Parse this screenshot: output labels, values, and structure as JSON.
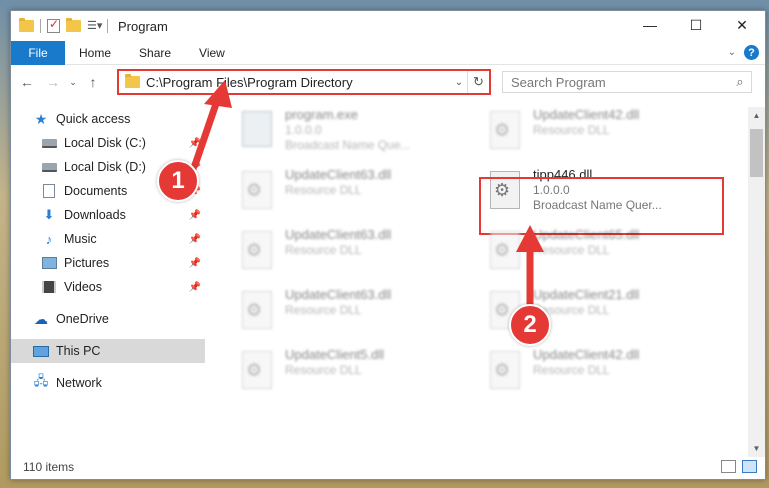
{
  "window": {
    "title": "Program",
    "controls": {
      "minimize": "—",
      "maximize": "☐",
      "close": "✕"
    }
  },
  "ribbon": {
    "tabs": [
      "File",
      "Home",
      "Share",
      "View"
    ],
    "help": "?"
  },
  "nav": {
    "address": "C:\\Program Files\\Program Directory",
    "search_placeholder": "Search Program"
  },
  "sidebar": {
    "items": [
      {
        "label": "Quick access",
        "icon": "star-icon"
      },
      {
        "label": "Local Disk (C:)",
        "icon": "drive-icon",
        "pinned": true
      },
      {
        "label": "Local Disk (D:)",
        "icon": "drive-icon",
        "pinned": true
      },
      {
        "label": "Documents",
        "icon": "documents-icon",
        "pinned": true
      },
      {
        "label": "Downloads",
        "icon": "downloads-icon",
        "pinned": true
      },
      {
        "label": "Music",
        "icon": "music-icon",
        "pinned": true
      },
      {
        "label": "Pictures",
        "icon": "pictures-icon",
        "pinned": true
      },
      {
        "label": "Videos",
        "icon": "videos-icon",
        "pinned": true
      },
      {
        "label": "OneDrive",
        "icon": "onedrive-icon"
      },
      {
        "label": "This PC",
        "icon": "this-pc-icon",
        "selected": true
      },
      {
        "label": "Network",
        "icon": "network-icon"
      }
    ]
  },
  "files": [
    {
      "name": "program.exe",
      "line1": "1.0.0.0",
      "line2": "Broadcast Name Que...",
      "icon": "exe-icon",
      "blurred": true
    },
    {
      "name": "UpdateClient42.dll",
      "line1": "Resource DLL",
      "icon": "dll-icon",
      "blurred": true
    },
    {
      "name": "UpdateClient63.dll",
      "line1": "Resource DLL",
      "icon": "dll-icon",
      "blurred": true
    },
    {
      "name": "tipp446.dll",
      "line1": "1.0.0.0",
      "line2": "Broadcast Name Quer...",
      "icon": "dll-icon",
      "blurred": false
    },
    {
      "name": "UpdateClient63.dll",
      "line1": "Resource DLL",
      "icon": "dll-icon",
      "blurred": true
    },
    {
      "name": "UpdateClient65.dll",
      "line1": "Resource DLL",
      "icon": "dll-icon",
      "blurred": true
    },
    {
      "name": "UpdateClient63.dll",
      "line1": "Resource DLL",
      "icon": "dll-icon",
      "blurred": true
    },
    {
      "name": "UpdateClient21.dll",
      "line1": "Resource DLL",
      "icon": "dll-icon",
      "blurred": true
    },
    {
      "name": "UpdateClient5.dll",
      "line1": "Resource DLL",
      "icon": "dll-icon",
      "blurred": true
    },
    {
      "name": "UpdateClient42.dll",
      "line1": "Resource DLL",
      "icon": "dll-icon",
      "blurred": true
    }
  ],
  "status": {
    "count": "110 items"
  },
  "annotations": {
    "step1": "1",
    "step2": "2",
    "color": "#e53935"
  }
}
